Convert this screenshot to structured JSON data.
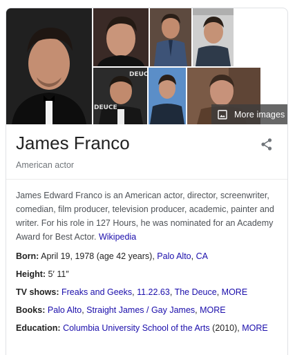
{
  "gallery": {
    "more_images_label": "More images",
    "photos": [
      {
        "name": "main-photo",
        "bg": "#1b1b1b",
        "skin": "#c48e72",
        "hair": "#1e1612",
        "shirt": "#0d0d0d"
      },
      {
        "name": "photo-2",
        "bg": "#3a2a26",
        "skin": "#c9957a",
        "hair": "#241a14",
        "shirt": "#111111"
      },
      {
        "name": "photo-3",
        "bg": "#5d4a3f",
        "skin": "#c28b6e",
        "hair": "#2a1f18",
        "shirt": "#3d5377"
      },
      {
        "name": "photo-4",
        "bg": "#cfcfcf",
        "skin": "#c59276",
        "hair": "#2a1f18",
        "shirt": "#2e3a4a"
      },
      {
        "name": "photo-5",
        "bg": "#2b2b2b",
        "skin": "#c18a6d",
        "hair": "#1f1812",
        "shirt": "#161616"
      },
      {
        "name": "photo-6",
        "bg": "#5b8ec8",
        "skin": "#c8957a",
        "hair": "#2a1f18",
        "shirt": "#1e2a3a"
      },
      {
        "name": "photo-7",
        "bg": "#7a5a46",
        "skin": "#c7927a",
        "hair": "#3a2a20",
        "shirt": "#5a3e2c"
      }
    ],
    "overlay_texts": [
      "DEUCE",
      "DEUCE"
    ]
  },
  "header": {
    "title": "James Franco",
    "subtitle": "American actor"
  },
  "description": {
    "text": "James Edward Franco is an American actor, director, screenwriter, comedian, film producer, television producer, academic, painter and writer. For his role in 127 Hours, he was nominated for an Academy Award for Best Actor.",
    "source_link": "Wikipedia"
  },
  "facts": {
    "born": {
      "label": "Born:",
      "text": "April 19, 1978 (age 42 years),",
      "link1": "Palo Alto",
      "sep": ",",
      "link2": "CA"
    },
    "height": {
      "label": "Height:",
      "text": "5′ 11″"
    },
    "tv_shows": {
      "label": "TV shows:",
      "items": [
        "Freaks and Geeks",
        "11.22.63",
        "The Deuce",
        "MORE"
      ]
    },
    "books": {
      "label": "Books:",
      "items": [
        "Palo Alto",
        "Straight James / Gay James",
        "MORE"
      ]
    },
    "education": {
      "label": "Education:",
      "link": "Columbia University School of the Arts",
      "text": "(2010),",
      "more": "MORE"
    }
  },
  "colors": {
    "link": "#1a0dab",
    "border": "#dfe1e5",
    "subtitle": "#70757a"
  },
  "icons": {
    "more_images": "image-icon",
    "share": "share-icon"
  }
}
